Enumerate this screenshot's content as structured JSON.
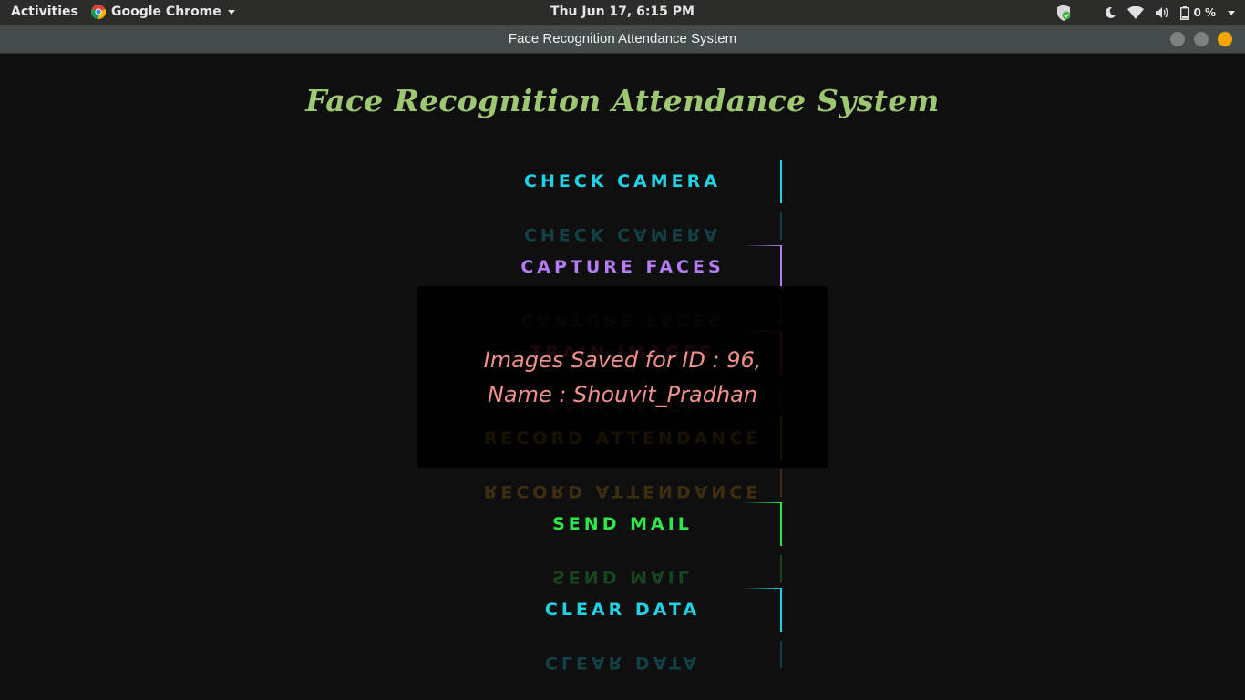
{
  "topbar": {
    "activities": "Activities",
    "app_name": "Google Chrome",
    "clock": "Thu Jun 17,  6:15 PM",
    "battery": "0 %"
  },
  "window": {
    "title": "Face Recognition Attendance System"
  },
  "page": {
    "title": "Face Recognition Attendance System",
    "buttons": [
      {
        "label": "CHECK CAMERA",
        "color": "#1fd3e6"
      },
      {
        "label": "CAPTURE FACES",
        "color": "#b57cf5"
      },
      {
        "label": "TRAIN IMAGES",
        "color": "#e23b7a"
      },
      {
        "label": "RECORD ATTENDANCE",
        "color": "#c98a10"
      },
      {
        "label": "SEND MAIL",
        "color": "#2ee84a"
      },
      {
        "label": "CLEAR DATA",
        "color": "#1fd3e6"
      }
    ]
  },
  "toast": {
    "line1": "Images Saved for ID : 96,",
    "line2": "Name : Shouvit_Pradhan"
  }
}
